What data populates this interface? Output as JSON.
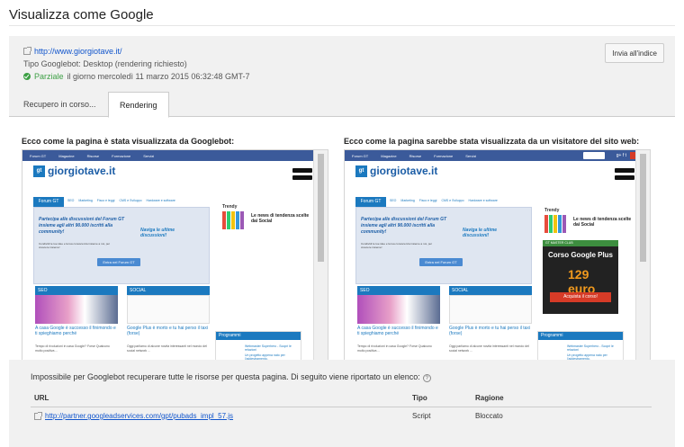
{
  "page_title": "Visualizza come Google",
  "info": {
    "url": "http://www.giorgiotave.it/",
    "googlebot_type": "Tipo Googlebot: Desktop (rendering richiesto)",
    "status_word": "Parziale",
    "status_rest": "il giorno mercoledì 11 marzo 2015 06:32:48 GMT-7",
    "submit_button": "Invia all'indice"
  },
  "tabs": [
    "Recupero in corso...",
    "Rendering"
  ],
  "captions": {
    "googlebot": "Ecco come la pagina è stata visualizzata da Googlebot:",
    "visitor": "Ecco come la pagina sarebbe stata visualizzata da un visitatore del sito web:"
  },
  "site": {
    "nav": [
      "Forum GT",
      "Magazine",
      "Risorse",
      "Formazione",
      "Servizi"
    ],
    "logo": "giorgiotave.it",
    "logo_mark": "gt",
    "forum_tab": "Forum GT",
    "subnav": [
      "SEO",
      "Marketing",
      "Fisco e leggi",
      "CMS e Sviluppo",
      "Hardware e software"
    ],
    "promo_text": "Partecipa alle discussioni del Forum GT insieme agli altri 90.000 iscritti alla community!",
    "promo_sub": "Condividi le tue idee e la tua conoscenza insieme a noi, per crescere insieme!",
    "promo_note": "Naviga le ultime discussioni!",
    "promo_button": "Entra nel Forum GT",
    "trendy": "Trendy",
    "trendy_text": "Le news di tendenza scelte dai Social",
    "sec_seo": "SEO",
    "sec_social": "SOCIAL",
    "seo_title": "A casa Google è successo il finimondo e ti spieghiamo perché",
    "seo_text": "Tempo di rivoluzioni in casa Google? Forse Qualcuno molto positiva ...",
    "social_title": "Google Plus è morto e tu hai perso il taxi (forse)",
    "social_text": "Oggi parliamo di alcune novità interessanti nel mondo del social network ...",
    "programmi": "Programmi",
    "prog_items": [
      "Webmaster Superhero - Scopri le relazioni",
      "Un progetto appena nato per l'addestramento."
    ],
    "ad_top": "GT MASTER CLUB",
    "ad_title": "Corso Google Plus",
    "ad_price": "129 euro",
    "ad_button": "Acquista il corso!"
  },
  "issues": {
    "message": "Impossibile per Googlebot recuperare tutte le risorse per questa pagina. Di seguito viene riportato un elenco:",
    "headers": [
      "URL",
      "Tipo",
      "Ragione"
    ],
    "rows": [
      {
        "url": "http://partner.googleadservices.com/gpt/pubads_impl_57.js",
        "type": "Script",
        "reason": "Bloccato"
      }
    ]
  }
}
